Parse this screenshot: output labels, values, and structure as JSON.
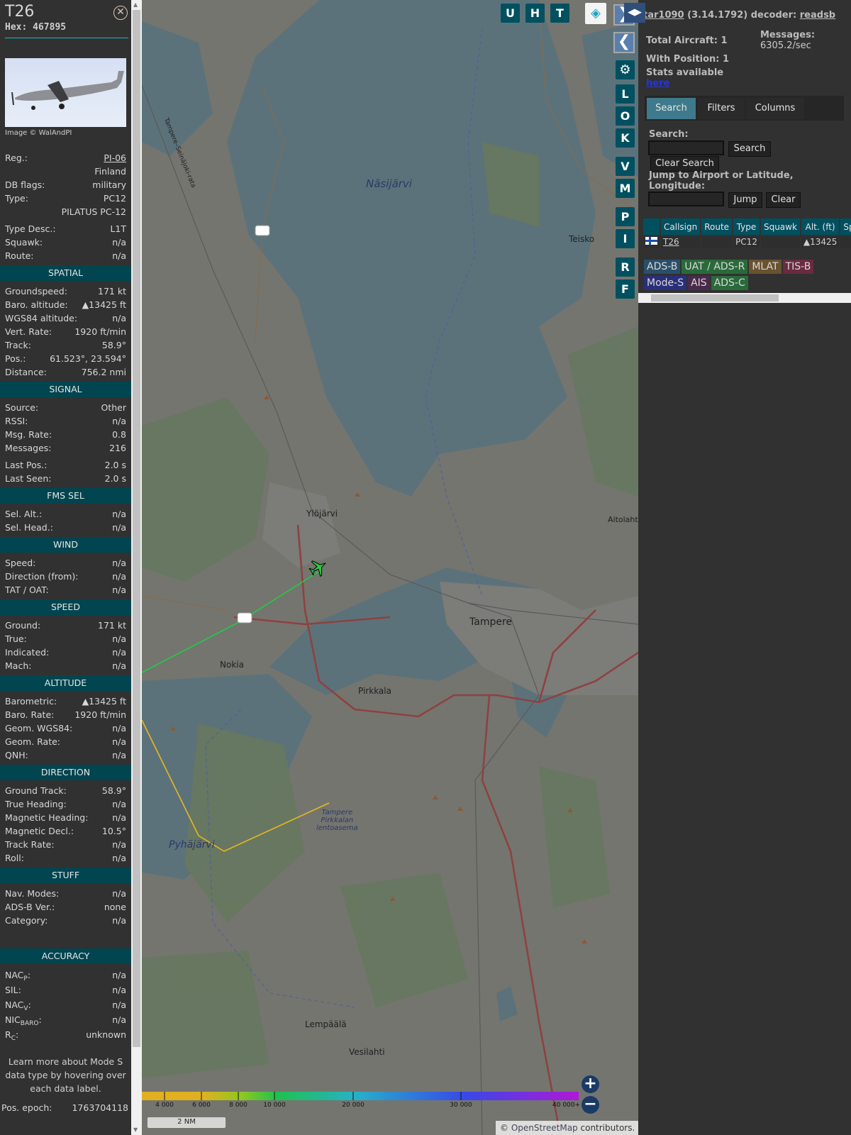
{
  "detail": {
    "title": "T26",
    "hex": "Hex: 467895",
    "close_icon": "close-circle-icon",
    "image_credit": "Image © WalAndPI",
    "info": [
      {
        "label": "Reg.:",
        "value": "PI-06",
        "link": true
      },
      {
        "label": "",
        "value": "Finland"
      },
      {
        "label": "DB flags:",
        "value": "military"
      },
      {
        "label": "Type:",
        "value": "PC12"
      },
      {
        "label": "",
        "value": "PILATUS PC-12"
      },
      {
        "label": "Type Desc.:",
        "value": "L1T"
      },
      {
        "label": "Squawk:",
        "value": "n/a"
      },
      {
        "label": "Route:",
        "value": "n/a"
      }
    ],
    "sections": [
      {
        "title": "SPATIAL",
        "rows": [
          [
            "Groundspeed:",
            "171 kt"
          ],
          [
            "Baro. altitude:",
            "▲13425 ft"
          ],
          [
            "WGS84 altitude:",
            "n/a"
          ],
          [
            "Vert. Rate:",
            "1920 ft/min"
          ],
          [
            "Track:",
            "58.9°"
          ],
          [
            "Pos.:",
            "61.523°, 23.594°"
          ],
          [
            "Distance:",
            "756.2 nmi"
          ]
        ]
      },
      {
        "title": "SIGNAL",
        "rows": [
          [
            "Source:",
            "Other"
          ],
          [
            "RSSI:",
            "n/a"
          ],
          [
            "Msg. Rate:",
            "0.8"
          ],
          [
            "Messages:",
            "216"
          ],
          [
            "Last Pos.:",
            "2.0 s"
          ],
          [
            "Last Seen:",
            "2.0 s"
          ]
        ]
      },
      {
        "title": "FMS SEL",
        "rows": [
          [
            "Sel. Alt.:",
            "n/a"
          ],
          [
            "Sel. Head.:",
            "n/a"
          ]
        ]
      },
      {
        "title": "WIND",
        "rows": [
          [
            "Speed:",
            "n/a"
          ],
          [
            "Direction (from):",
            "n/a"
          ],
          [
            "TAT / OAT:",
            "n/a"
          ]
        ]
      },
      {
        "title": "SPEED",
        "rows": [
          [
            "Ground:",
            "171 kt"
          ],
          [
            "True:",
            "n/a"
          ],
          [
            "Indicated:",
            "n/a"
          ],
          [
            "Mach:",
            "n/a"
          ]
        ]
      },
      {
        "title": "ALTITUDE",
        "rows": [
          [
            "Barometric:",
            "▲13425 ft"
          ],
          [
            "Baro. Rate:",
            "1920 ft/min"
          ],
          [
            "Geom. WGS84:",
            "n/a"
          ],
          [
            "Geom. Rate:",
            "n/a"
          ],
          [
            "QNH:",
            "n/a"
          ]
        ]
      },
      {
        "title": "DIRECTION",
        "rows": [
          [
            "Ground Track:",
            "58.9°"
          ],
          [
            "True Heading:",
            "n/a"
          ],
          [
            "Magnetic Heading:",
            "n/a"
          ],
          [
            "Magnetic Decl.:",
            "10.5°"
          ],
          [
            "Track Rate:",
            "n/a"
          ],
          [
            "Roll:",
            "n/a"
          ]
        ]
      },
      {
        "title": "STUFF",
        "rows": [
          [
            "Nav. Modes:",
            "n/a"
          ],
          [
            "ADS-B Ver.:",
            "none"
          ],
          [
            "Category:",
            "n/a"
          ]
        ]
      }
    ],
    "accuracy": {
      "title": "ACCURACY",
      "rows": [
        {
          "label": "NAC",
          "sub": "P",
          "value": "n/a"
        },
        {
          "label": "SIL",
          "sub": "",
          "value": "n/a"
        },
        {
          "label": "NAC",
          "sub": "V",
          "value": "n/a"
        },
        {
          "label": "NIC",
          "sub": "BARO",
          "value": "n/a"
        },
        {
          "label": "R",
          "sub": "C",
          "value": "unknown"
        }
      ]
    },
    "learn_more": "Learn more about Mode S data type by hovering over each data label.",
    "pos_epoch_label": "Pos. epoch:",
    "pos_epoch": "1763704118"
  },
  "map": {
    "top_buttons": [
      "U",
      "H",
      "T"
    ],
    "side_buttons": [
      "L",
      "O",
      "K",
      "V",
      "M",
      "P",
      "I",
      "R",
      "F"
    ],
    "places": {
      "nasijarvi": "Näsijärvi",
      "teisko": "Teisko",
      "ylojarvi": "Ylöjärvi",
      "tampere": "Tampere",
      "aitolahti": "Aitolahti",
      "nokia": "Nokia",
      "pirkkala": "Pirkkala",
      "pyhajarvi": "Pyhäjärvi",
      "lempaala": "Lempäälä",
      "vesilahti": "Vesilahti",
      "airport1": "Tampere",
      "airport2": "Pirkkalan",
      "airport3": "lentoasema",
      "rail": "Tampere–Seinäjoki-rata"
    },
    "color_scale": [
      "4 000",
      "6 000",
      "8 000",
      "10 000",
      "20 000",
      "30 000",
      "40 000+"
    ],
    "scale_label": "2 NM",
    "attribution_prefix": "©",
    "attribution_link": "OpenStreetMap",
    "attribution_suffix": "contributors.",
    "track_colors": {
      "green": "#22cc44",
      "yellow": "#e8b820"
    }
  },
  "panel": {
    "app": "tar1090",
    "version": "(3.14.1792) decoder:",
    "decoder": "readsb",
    "total_aircraft": "Total Aircraft: 1",
    "with_position": "With Position: 1",
    "messages_label": "Messages:",
    "messages_value": "6305.2/sec",
    "stats_text": "Stats available",
    "stats_link": "here",
    "tabs": [
      "Search",
      "Filters",
      "Columns"
    ],
    "search_label": "Search:",
    "search_button": "Search",
    "clear_search": "Clear Search",
    "jump_label_1": "Jump to Airport or Latitude,",
    "jump_label_2": "Longitude:",
    "jump_button": "Jump",
    "clear_button": "Clear",
    "columns": [
      "",
      "Callsign",
      "Route",
      "Type",
      "Squawk",
      "Alt. (ft)",
      "Spd"
    ],
    "rows": [
      {
        "callsign": "T26",
        "route": "",
        "type": "PC12",
        "squawk": "",
        "alt": "▲13425",
        "spd": ""
      }
    ],
    "legend": [
      {
        "label": "ADS-B",
        "color": "#2a4f6a"
      },
      {
        "label": "UAT / ADS-R",
        "color": "#2a6a3a"
      },
      {
        "label": "MLAT",
        "color": "#6a5230"
      },
      {
        "label": "TIS-B",
        "color": "#6a2a40"
      },
      {
        "label": "Mode-S",
        "color": "#2a2f7a"
      },
      {
        "label": "AIS",
        "color": "#4a2a4a"
      },
      {
        "label": "ADS-C",
        "color": "#2a6a3a"
      }
    ]
  }
}
